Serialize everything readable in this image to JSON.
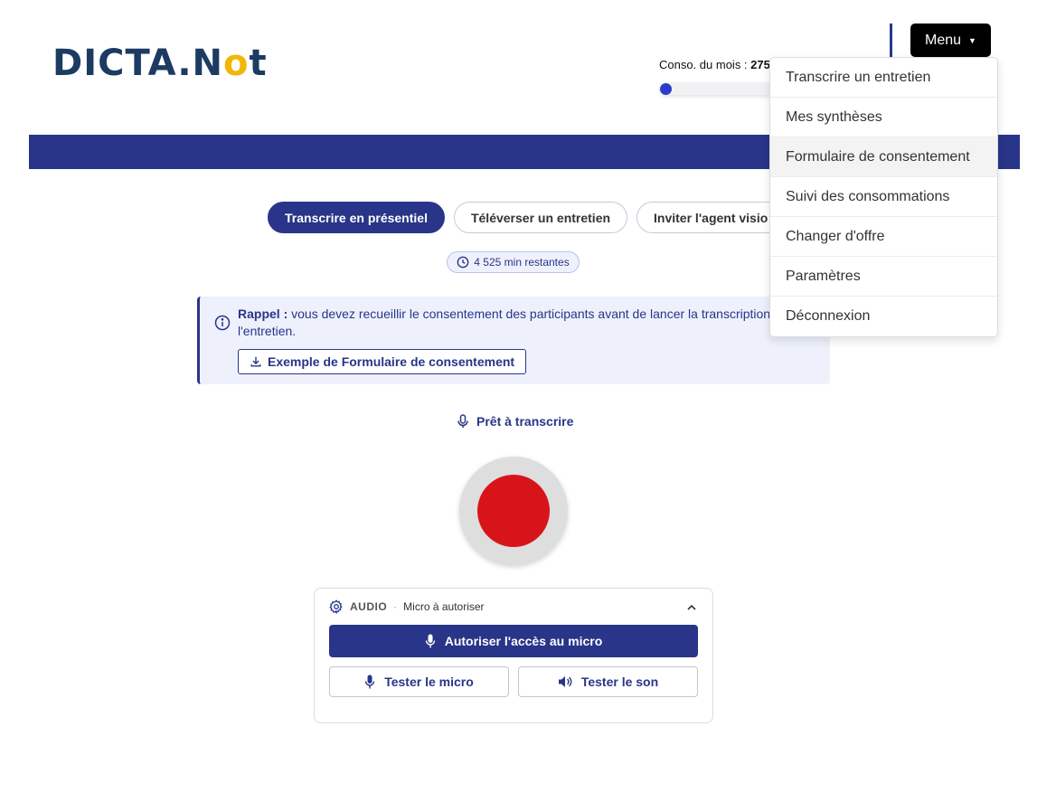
{
  "header": {
    "logo": {
      "part1": "D",
      "part2": "I",
      "part3": "CTA.N",
      "part4": "o",
      "part5": "t"
    },
    "conso_label": "Conso. du mois : ",
    "conso_value": "275",
    "menu_label": "Menu",
    "usage_fraction": 0.0
  },
  "dropdown": {
    "items": [
      "Transcrire un entretien",
      "Mes synthèses",
      "Formulaire de consentement",
      "Suivi des consommations",
      "Changer d'offre",
      "Paramètres",
      "Déconnexion"
    ]
  },
  "tabs": [
    "Transcrire en présentiel",
    "Téléverser un entretien",
    "Inviter l'agent visio"
  ],
  "remaining": "4 525 min restantes",
  "alert": {
    "bold": "Rappel :",
    "text": " vous devez recueillir le consentement des participants avant de lancer la transcription de l'entretien.",
    "button": "Exemple de Formulaire de consentement"
  },
  "status": "Prêt à transcrire",
  "audio": {
    "label": "AUDIO",
    "separator": "·",
    "state": "Micro à autoriser",
    "authorize": "Autoriser l'accès au micro",
    "test_mic": "Tester le micro",
    "test_sound": "Tester le son"
  },
  "colors": {
    "primary": "#283588",
    "record": "#d8141b",
    "logo_accent": "#f2b705"
  }
}
